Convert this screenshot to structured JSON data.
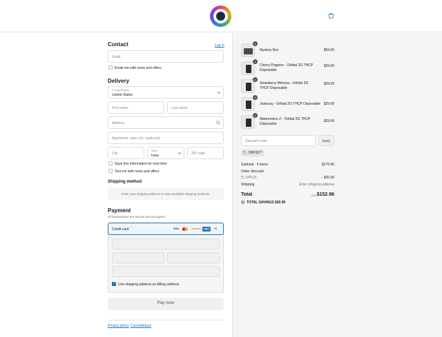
{
  "header": {
    "logo_icon": "store-logo",
    "bag_icon": "shopping-bag-icon"
  },
  "contact": {
    "title": "Contact",
    "login_link": "Log in",
    "email_placeholder": "Email",
    "news_checkbox_label": "Email me with news and offers",
    "news_checked": false
  },
  "delivery": {
    "title": "Delivery",
    "country_label": "Country/Region",
    "country_value": "United States",
    "first_name_placeholder": "First name",
    "last_name_placeholder": "Last name",
    "address_placeholder": "Address",
    "apartment_placeholder": "Apartment, suite, etc. (optional)",
    "city_placeholder": "City",
    "state_label": "State",
    "state_value": "Iowa",
    "zip_placeholder": "ZIP code",
    "save_info_label": "Save this information for next time",
    "text_offers_label": "Text me with news and offers"
  },
  "shipping": {
    "title": "Shipping method",
    "info": "Enter your shipping address to view available shipping methods."
  },
  "payment": {
    "title": "Payment",
    "subtitle": "All transactions are secure and encrypted.",
    "method_label": "Credit card",
    "card_brands": [
      "VISA",
      "MC",
      "DISCOVER",
      "AMEX",
      "+6"
    ],
    "billing_label": "Use shipping address as billing address",
    "billing_checked": true,
    "pay_button": "Pay now"
  },
  "footer": {
    "privacy_link": "Privacy policy",
    "cancellations_link": "Cancellations"
  },
  "order": {
    "items": [
      {
        "qty": "1",
        "name": "Mystery Box",
        "price": "$59.99"
      },
      {
        "qty": "1",
        "name": "Cherry Poppers - Orbital 2G THCP Disposable",
        "price": "$29.99"
      },
      {
        "qty": "1",
        "name": "Strawberry Mimosa - Orbital 2G THCP Disposable",
        "price": "$29.99"
      },
      {
        "qty": "1",
        "name": "Jealousy - Orbital 2G THCP Disposable",
        "price": "$29.99"
      },
      {
        "qty": "1",
        "name": "Watermelon Z - Orbital 2G THCP Disposable",
        "price": "$29.99"
      }
    ],
    "discount_placeholder": "Discount code",
    "apply_button": "Apply",
    "applied_code": "DPF15",
    "subtotal_label": "Subtotal · 5 items",
    "subtotal_value": "$179.95",
    "order_discount_label": "Order discount",
    "discount_code": "DPF15",
    "discount_value": "- $26.99",
    "shipping_label": "Shipping",
    "shipping_value": "Enter shipping address",
    "total_label": "Total",
    "currency": "USD",
    "total_value": "$152.96",
    "savings_label": "TOTAL SAVINGS",
    "savings_value": "$26.99"
  }
}
